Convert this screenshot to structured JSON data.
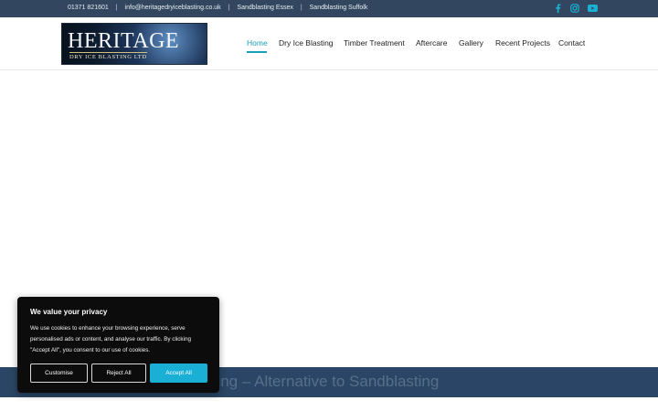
{
  "topbar": {
    "phone": "01371 821601",
    "email": "info@heritagedryiceblasting.co.uk",
    "link1": "Sandblasting Essex",
    "link2": "Sandblasting Suffolk",
    "separator": "|",
    "social_icons": [
      "facebook-icon",
      "instagram-icon",
      "youtube-icon"
    ],
    "accent": "#1ab0d6",
    "background": "#32475f"
  },
  "logo": {
    "word": "HERITAGE",
    "sub": "DRY ICE BLASTING LTD"
  },
  "nav": {
    "items": [
      "Home",
      "Dry Ice Blasting",
      "Timber Treatment",
      "Aftercare",
      "Gallery",
      "Recent Projects",
      "Contact"
    ],
    "active": "Home",
    "active_color": "#1a9fb8"
  },
  "banner": {
    "text": "Blasting – Alternative to Sandblasting",
    "background": "#2a4565"
  },
  "cookie": {
    "title": "We value your privacy",
    "text": "We use cookies to enhance your browsing experience, serve personalised ads or content, and analyse our traffic. By clicking \"Accept All\", you consent to our use of cookies.",
    "customise": "Customise",
    "reject": "Reject All",
    "accept": "Accept All",
    "accept_color": "#1ab0d6"
  }
}
